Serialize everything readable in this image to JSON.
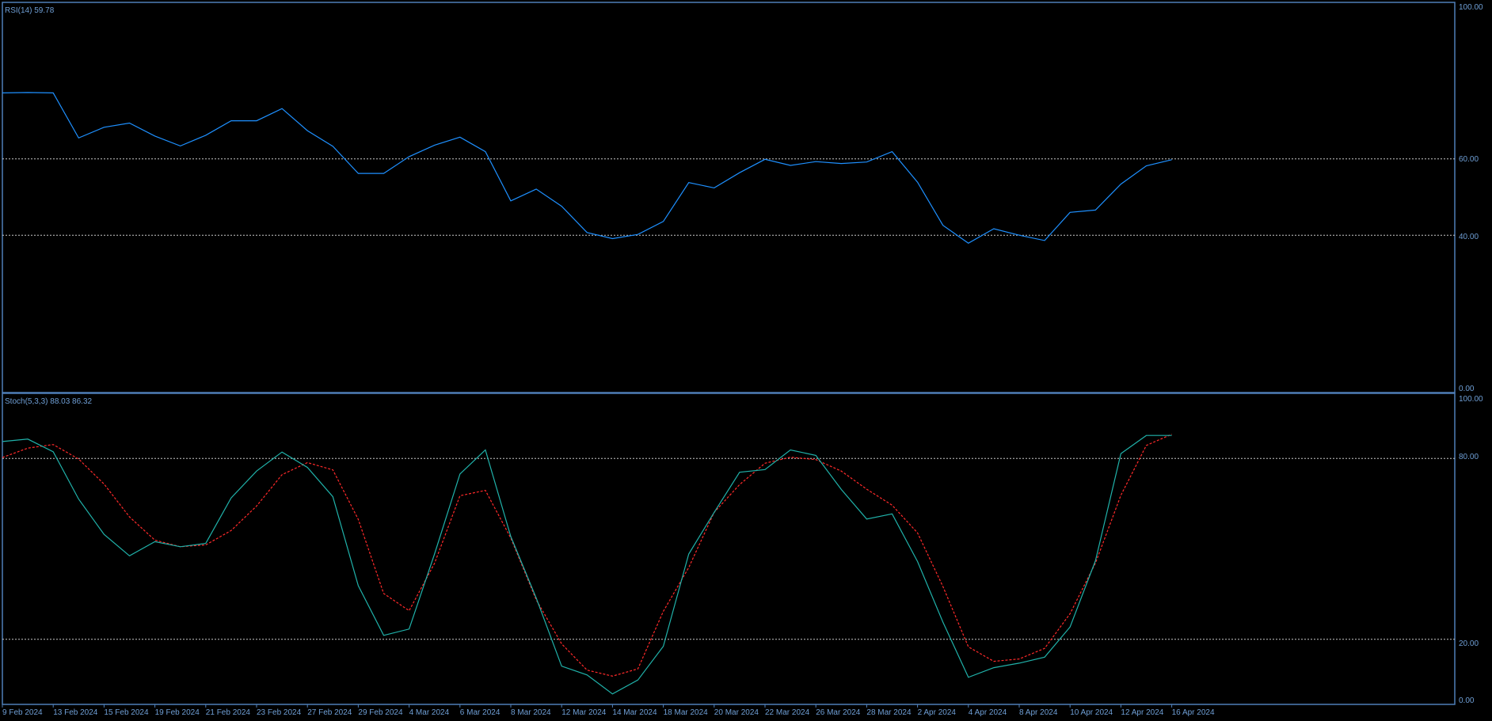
{
  "colors": {
    "background": "#000000",
    "frame": "#4f7fb8",
    "text": "#6f9fd6",
    "level_line": "#c8c8c8",
    "rsi_line": "#1e90ff",
    "stoch_main": "#20b2aa",
    "stoch_signal": "#ff2a2a"
  },
  "x_dates": [
    "9 Feb 2024",
    "13 Feb 2024",
    "15 Feb 2024",
    "19 Feb 2024",
    "21 Feb 2024",
    "23 Feb 2024",
    "27 Feb 2024",
    "29 Feb 2024",
    "4 Mar 2024",
    "6 Mar 2024",
    "8 Mar 2024",
    "12 Mar 2024",
    "14 Mar 2024",
    "18 Mar 2024",
    "20 Mar 2024",
    "22 Mar 2024",
    "26 Mar 2024",
    "28 Mar 2024",
    "2 Apr 2024",
    "4 Apr 2024",
    "8 Apr 2024",
    "10 Apr 2024",
    "12 Apr 2024",
    "16 Apr 2024"
  ],
  "chart_data": [
    {
      "type": "line",
      "title": "RSI(14) 59.78",
      "ylim": [
        0,
        100
      ],
      "ytick_labels": [
        "100.00",
        "60.00",
        "40.00",
        "0.00"
      ],
      "levels": [
        60,
        40
      ],
      "grid": false,
      "series": [
        {
          "values": [
            77.3,
            77.4,
            77.3,
            65.5,
            68.3,
            69.4,
            66.0,
            63.4,
            66.2,
            70.0,
            70.0,
            73.2,
            67.4,
            63.3,
            56.2,
            56.2,
            60.6,
            63.6,
            65.7,
            61.9,
            49.0,
            52.1,
            47.6,
            40.7,
            39.1,
            40.2,
            43.6,
            53.8,
            52.4,
            56.4,
            59.9,
            58.3,
            59.3,
            58.8,
            59.2,
            61.9,
            53.9,
            42.6,
            37.9,
            41.7,
            40.0,
            38.6,
            46.0,
            46.6,
            53.4,
            58.2,
            59.8
          ]
        }
      ]
    },
    {
      "type": "line",
      "title": "Stoch(5,3,3) 88.03 86.32",
      "ylim": [
        0,
        100
      ],
      "ytick_labels": [
        "100.00",
        "80.00",
        "20.00",
        "0.00"
      ],
      "levels": [
        80,
        20
      ],
      "grid": false,
      "series": [
        {
          "values": [
            85.6,
            86.4,
            82.2,
            66.5,
            54.8,
            47.7,
            52.4,
            50.7,
            51.8,
            66.9,
            75.8,
            82.1,
            77.0,
            67.3,
            37.8,
            21.3,
            23.4,
            48.3,
            74.8,
            82.8,
            54.1,
            33.7,
            11.1,
            8.2,
            1.9,
            6.5,
            17.7,
            48.3,
            62.1,
            75.4,
            76.3,
            82.8,
            81.0,
            69.7,
            59.9,
            61.6,
            45.8,
            25.7,
            7.4,
            10.6,
            12.1,
            14.1,
            24.1,
            46.1,
            81.6,
            87.6,
            87.6
          ]
        },
        {
          "values": [
            80.3,
            83.4,
            84.6,
            79.8,
            71.5,
            60.6,
            52.9,
            50.7,
            51.3,
            56.1,
            64.2,
            74.6,
            78.6,
            76.2,
            59.8,
            35.2,
            29.5,
            45.2,
            67.6,
            69.4,
            53.6,
            33.1,
            18.5,
            9.8,
            7.8,
            10.2,
            29.3,
            43.8,
            62.1,
            71.3,
            78.4,
            80.4,
            79.6,
            75.8,
            69.8,
            64.5,
            55.3,
            37.5,
            17.5,
            12.7,
            13.5,
            17.0,
            28.5,
            45.3,
            67.8,
            84.3,
            88.0
          ]
        }
      ]
    }
  ]
}
